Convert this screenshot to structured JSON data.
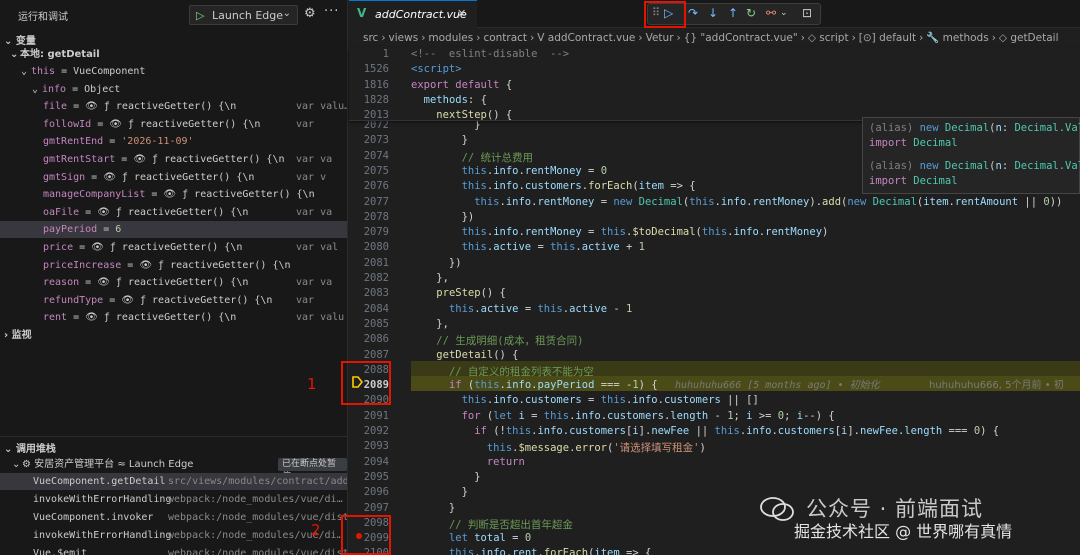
{
  "sidebar": {
    "title": "运行和调试",
    "launch_label": "Launch Edge",
    "variables_header": "变量",
    "local_header": "本地: getDetail",
    "watch_header": "监视",
    "callstack_header": "调用堆栈",
    "vars": [
      {
        "name": "this",
        "sep": " = ",
        "value": "VueComponent",
        "indent": 1,
        "expanded": true
      },
      {
        "name": "info",
        "sep": " = ",
        "value": "Object",
        "indent": 2,
        "expanded": true
      },
      {
        "name": "file",
        "sep": " = ",
        "value": "👁 ƒ reactiveGetter() {\\n",
        "tail": "var valu…",
        "indent": 3
      },
      {
        "name": "followId",
        "sep": " = ",
        "value": "👁 ƒ reactiveGetter() {\\n",
        "tail": "var",
        "indent": 3
      },
      {
        "name": "gmtRentEnd",
        "sep": " = ",
        "value": "'2026-11-09'",
        "indent": 3,
        "kind": "str"
      },
      {
        "name": "gmtRentStart",
        "sep": " = ",
        "value": "👁 ƒ reactiveGetter() {\\n",
        "tail": "var va",
        "indent": 3
      },
      {
        "name": "gmtSign",
        "sep": " = ",
        "value": "👁 ƒ reactiveGetter() {\\n",
        "tail": "var v",
        "indent": 3
      },
      {
        "name": "manageCompanyList",
        "sep": " = ",
        "value": "👁 ƒ reactiveGetter() {\\n",
        "tail": "",
        "indent": 3
      },
      {
        "name": "oaFile",
        "sep": " = ",
        "value": "👁 ƒ reactiveGetter() {\\n",
        "tail": "var va",
        "indent": 3
      },
      {
        "name": "payPeriod",
        "sep": " = ",
        "value": "6",
        "indent": 3,
        "kind": "num",
        "selected": true
      },
      {
        "name": "price",
        "sep": " = ",
        "value": "👁 ƒ reactiveGetter() {\\n",
        "tail": "var val",
        "indent": 3
      },
      {
        "name": "priceIncrease",
        "sep": " = ",
        "value": "👁 ƒ reactiveGetter() {\\n",
        "tail": "",
        "indent": 3
      },
      {
        "name": "reason",
        "sep": " = ",
        "value": "👁 ƒ reactiveGetter() {\\n",
        "tail": "var va",
        "indent": 3
      },
      {
        "name": "refundType",
        "sep": " = ",
        "value": "👁 ƒ reactiveGetter() {\\n",
        "tail": "var",
        "indent": 3
      },
      {
        "name": "rent",
        "sep": " = ",
        "value": "👁 ƒ reactiveGetter() {\\n",
        "tail": "var valu",
        "indent": 3
      }
    ],
    "session_label": "安居资产管理平台 ≈ Launch Edge",
    "paused_badge": "已在断点处暂停",
    "stack": [
      {
        "fn": "VueComponent.getDetail",
        "src": "src/views/modules/contract/addC…",
        "selected": true
      },
      {
        "fn": "invokeWithErrorHandling",
        "src": "webpack:/node_modules/vue/di…"
      },
      {
        "fn": "VueComponent.invoker",
        "src": "webpack:/node_modules/vue/dist/vu…"
      },
      {
        "fn": "invokeWithErrorHandling",
        "src": "webpack:/node_modules/vue/di…"
      },
      {
        "fn": "Vue.$emit",
        "src": "webpack:/node_modules/vue/dist/vue.runtime.es…"
      }
    ]
  },
  "editor": {
    "tab_label": "addContract.vue",
    "breadcrumb": [
      "src",
      "›",
      "views",
      "›",
      "modules",
      "›",
      "contract",
      "›",
      "V addContract.vue",
      "›",
      "Vetur",
      "›",
      "{} \"addContract.vue\"",
      "›",
      "◇ script",
      "›",
      "[⊙] default",
      "›",
      "🔧 methods",
      "›",
      "◇ getDetail"
    ],
    "sticky_lines": [
      {
        "n": "1",
        "html": "<span class='gray'>&lt;!--  eslint-disable  --&gt;</span>"
      },
      {
        "n": "1526",
        "html": "<span class='tag'>&lt;script&gt;</span>"
      },
      {
        "n": "1816",
        "html": "<span class='kw2'>export default</span> {"
      },
      {
        "n": "1828",
        "html": "  <span class='prop'>methods</span>: {"
      },
      {
        "n": "2013",
        "html": "    <span class='fn'>nextStep</span>() {"
      }
    ],
    "lines": [
      {
        "n": "2072",
        "html": "          }"
      },
      {
        "n": "2073",
        "html": "        }"
      },
      {
        "n": "2074",
        "html": "        <span class='cmt'>// 统计总费用</span>"
      },
      {
        "n": "2075",
        "html": "        <span class='kw'>this</span>.<span class='prop'>info</span>.<span class='prop'>rentMoney</span> = <span class='num'>0</span>"
      },
      {
        "n": "2076",
        "html": "        <span class='kw'>this</span>.<span class='prop'>info</span>.<span class='prop'>customers</span>.<span class='fn'>forEach</span>(<span class='prop'>item</span> =&gt; {"
      },
      {
        "n": "2077",
        "html": "          <span class='kw'>this</span>.<span class='prop'>info</span>.<span class='prop'>rentMoney</span> = <span class='kw'>new</span> <span class='cls'>Decimal</span>(<span class='kw'>this</span>.<span class='prop'>info</span>.<span class='prop'>rentMoney</span>).<span class='fn'>add</span>(<span class='kw'>new</span> <span class='cls'>Decimal</span>(<span class='prop'>item</span>.<span class='prop'>rentAmount</span> || <span class='num'>0</span>))"
      },
      {
        "n": "2078",
        "html": "        })"
      },
      {
        "n": "2079",
        "html": "        <span class='kw'>this</span>.<span class='prop'>info</span>.<span class='prop'>rentMoney</span> = <span class='kw'>this</span>.<span class='fn'>$toDecimal</span>(<span class='kw'>this</span>.<span class='prop'>info</span>.<span class='prop'>rentMoney</span>)"
      },
      {
        "n": "2080",
        "html": "        <span class='kw'>this</span>.<span class='prop'>active</span> = <span class='kw'>this</span>.<span class='prop'>active</span> + <span class='num'>1</span>"
      },
      {
        "n": "2081",
        "html": "      })"
      },
      {
        "n": "2082",
        "html": "    },"
      },
      {
        "n": "2083",
        "html": "    <span class='fn'>preStep</span>() {"
      },
      {
        "n": "2084",
        "html": "      <span class='kw'>this</span>.<span class='prop'>active</span> = <span class='kw'>this</span>.<span class='prop'>active</span> - <span class='num'>1</span>"
      },
      {
        "n": "2085",
        "html": "    },"
      },
      {
        "n": "2086",
        "html": "    <span class='cmt'>// 生成明细(成本，租赁合同)</span>"
      },
      {
        "n": "2087",
        "html": "    <span class='fn'>getDetail</span>() {"
      },
      {
        "n": "2088",
        "html": "      <span class='cmt'>// 自定义的租金列表不能为空</span>"
      },
      {
        "n": "2089",
        "html": "      <span class='kw2'>if</span> (<span class='kw'>this</span>.<span class='prop'>info</span>.<span class='prop'>payPeriod</span> === -<span class='num'>1</span>) {"
      },
      {
        "n": "2090",
        "html": "        <span class='kw'>this</span>.<span class='prop'>info</span>.<span class='prop'>customers</span> = <span class='kw'>this</span>.<span class='prop'>info</span>.<span class='prop'>customers</span> || []"
      },
      {
        "n": "2091",
        "html": "        <span class='kw2'>for</span> (<span class='kw'>let</span> <span class='prop'>i</span> = <span class='kw'>this</span>.<span class='prop'>info</span>.<span class='prop'>customers</span>.<span class='prop'>length</span> - <span class='num'>1</span>; <span class='prop'>i</span> &gt;= <span class='num'>0</span>; <span class='prop'>i</span>--) {"
      },
      {
        "n": "2092",
        "html": "          <span class='kw2'>if</span> (!<span class='kw'>this</span>.<span class='prop'>info</span>.<span class='prop'>customers</span>[<span class='prop'>i</span>].<span class='prop'>newFee</span> || <span class='kw'>this</span>.<span class='prop'>info</span>.<span class='prop'>customers</span>[<span class='prop'>i</span>].<span class='prop'>newFee</span>.<span class='prop'>length</span> === <span class='num'>0</span>) {"
      },
      {
        "n": "2093",
        "html": "            <span class='kw'>this</span>.<span class='fn'>$message</span>.<span class='fn'>error</span>(<span class='str'>'请选择填写租金'</span>)"
      },
      {
        "n": "2094",
        "html": "            <span class='kw2'>return</span>"
      },
      {
        "n": "2095",
        "html": "          }"
      },
      {
        "n": "2096",
        "html": "        }"
      },
      {
        "n": "2097",
        "html": "      }"
      },
      {
        "n": "2098",
        "html": "      <span class='cmt'>// 判断是否超出首年超金</span>"
      },
      {
        "n": "2099",
        "html": "      <span class='kw'>let</span> <span class='prop'>total</span> = <span class='num'>0</span>"
      },
      {
        "n": "2100",
        "html": "      <span class='kw'>this</span>.<span class='prop'>info</span>.<span class='prop'>rent</span>.<span class='fn'>forEach</span>(<span class='prop'>item</span> =&gt; {"
      }
    ],
    "blame": "huhuhuhu666 [5 months ago] • 初始化",
    "blame2": "huhuhuhu666, 5个月前 • 初",
    "hover": [
      {
        "html": "<span class='gray'>(alias)</span> <span class='kw'>new</span> <span class='cls'>Decimal</span>(<span class='prop'>n</span>: <span class='cls'>Decimal.Valu</span>"
      },
      {
        "html": "<span class='kw2'>import</span> <span class='cls'>Decimal</span>"
      },
      {
        "html": "<span class='gray'>(alias)</span> <span class='kw'>new</span> <span class='cls'>Decimal</span>(<span class='prop'>n</span>: <span class='cls'>Decimal.Valu</span>"
      },
      {
        "html": "<span class='kw2'>import</span> <span class='cls'>Decimal</span>"
      }
    ]
  },
  "annotations": {
    "one": "1",
    "two": "2"
  },
  "watermark": {
    "line1": "公众号 · 前端面试",
    "line2": "掘金技术社区 @ 世界哪有真情"
  }
}
